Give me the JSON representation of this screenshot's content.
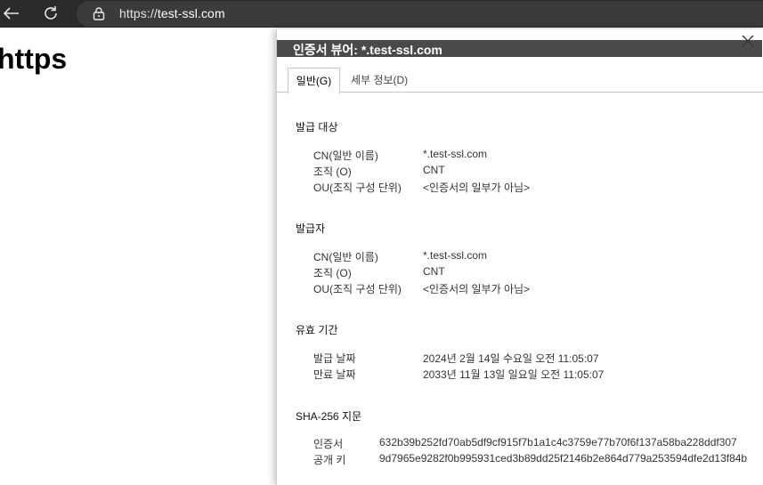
{
  "browser": {
    "url_scheme": "https://",
    "url_host": "test-ssl.com"
  },
  "page": {
    "heading": "https"
  },
  "dialog": {
    "title": "인증서 뷰어: *.test-ssl.com",
    "tabs": [
      {
        "label": "일반(G)",
        "active": true
      },
      {
        "label": "세부 정보(D)",
        "active": false
      }
    ],
    "issued_to": {
      "title": "발급 대상",
      "fields": [
        {
          "label": "CN(일반 이름)",
          "value": "*.test-ssl.com"
        },
        {
          "label": "조직 (O)",
          "value": "CNT"
        },
        {
          "label": "OU(조직 구성 단위)",
          "value": "<인증서의 일부가 아님>"
        }
      ]
    },
    "issued_by": {
      "title": "발급자",
      "fields": [
        {
          "label": "CN(일반 이름)",
          "value": "*.test-ssl.com"
        },
        {
          "label": "조직 (O)",
          "value": "CNT"
        },
        {
          "label": "OU(조직 구성 단위)",
          "value": "<인증서의 일부가 아님>"
        }
      ]
    },
    "validity": {
      "title": "유효 기간",
      "fields": [
        {
          "label": "발급 날짜",
          "value": "2024년 2월 14일 수요일 오전 11:05:07"
        },
        {
          "label": "만료 날짜",
          "value": "2033년 11월 13일 일요일 오전 11:05:07"
        }
      ]
    },
    "fingerprints": {
      "title": "SHA-256 지문",
      "fields": [
        {
          "label": "인증서",
          "value": "632b39b252fd70ab5df9cf915f7b1a1c4c3759e77b70f6f137a58ba228ddf307"
        },
        {
          "label": "공개 키",
          "value": "9d7965e9282f0b995931ced3b89dd25f2146b2e864d779a253594dfe2d13f84b"
        }
      ]
    }
  }
}
